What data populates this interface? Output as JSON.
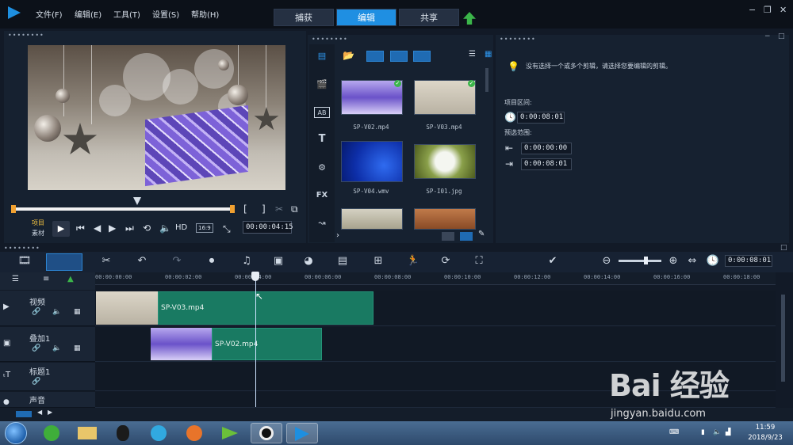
{
  "menu": {
    "file": "文件(F)",
    "edit": "编辑(E)",
    "tools": "工具(T)",
    "settings": "设置(S)",
    "help": "帮助(H)"
  },
  "modes": {
    "capture": "捕获",
    "edit": "编辑",
    "share": "共享"
  },
  "window": {
    "minimize": "−",
    "restore": "❐",
    "close": "✕"
  },
  "preview": {
    "project_label": "项目",
    "clip_label": "素材",
    "hd_label": "HD",
    "aspect": "16:9",
    "timecode": "00:00:04:15",
    "mark_in": "[",
    "mark_out": "]"
  },
  "library": {
    "side_fx": "FX",
    "side_ab": "AB",
    "side_t": "T",
    "items": [
      {
        "name": "SP-V02.mp4",
        "checked": true
      },
      {
        "name": "SP-V03.mp4",
        "checked": true
      },
      {
        "name": "SP-V04.wmv",
        "checked": false
      },
      {
        "name": "SP-I01.jpg",
        "checked": false
      }
    ]
  },
  "options": {
    "hint": "没有选择一个或多个剪辑，请选择您要编辑的剪辑。",
    "project_interval_label": "项目区间:",
    "project_interval": "0:00:08:01",
    "trim_range_label": "预选范围:",
    "trim_in": "0:00:00:00",
    "trim_out": "0:00:08:01"
  },
  "timeline": {
    "duration": "0:00:08:01",
    "ticks": [
      "00:00:00:00",
      "00:00:02:00",
      "00:00:04:00",
      "00:00:06:00",
      "00:00:08:00",
      "00:00:10:00",
      "00:00:12:00",
      "00:00:14:00",
      "00:00:16:00",
      "00:00:18:00"
    ],
    "tracks": [
      {
        "name": "视频",
        "clip": "SP-V03.mp4"
      },
      {
        "name": "叠加1",
        "clip": "SP-V02.mp4"
      },
      {
        "name": "标题1",
        "clip": ""
      },
      {
        "name": "声音",
        "clip": ""
      }
    ]
  },
  "taskbar": {
    "time": "11:59",
    "date": "2018/9/23"
  },
  "watermark": {
    "logo": "Bai 经验",
    "url": "jingyan.baidu.com"
  },
  "colors": {
    "accent": "#1f8fe2",
    "clip": "#197a62",
    "background": "#121a27"
  }
}
